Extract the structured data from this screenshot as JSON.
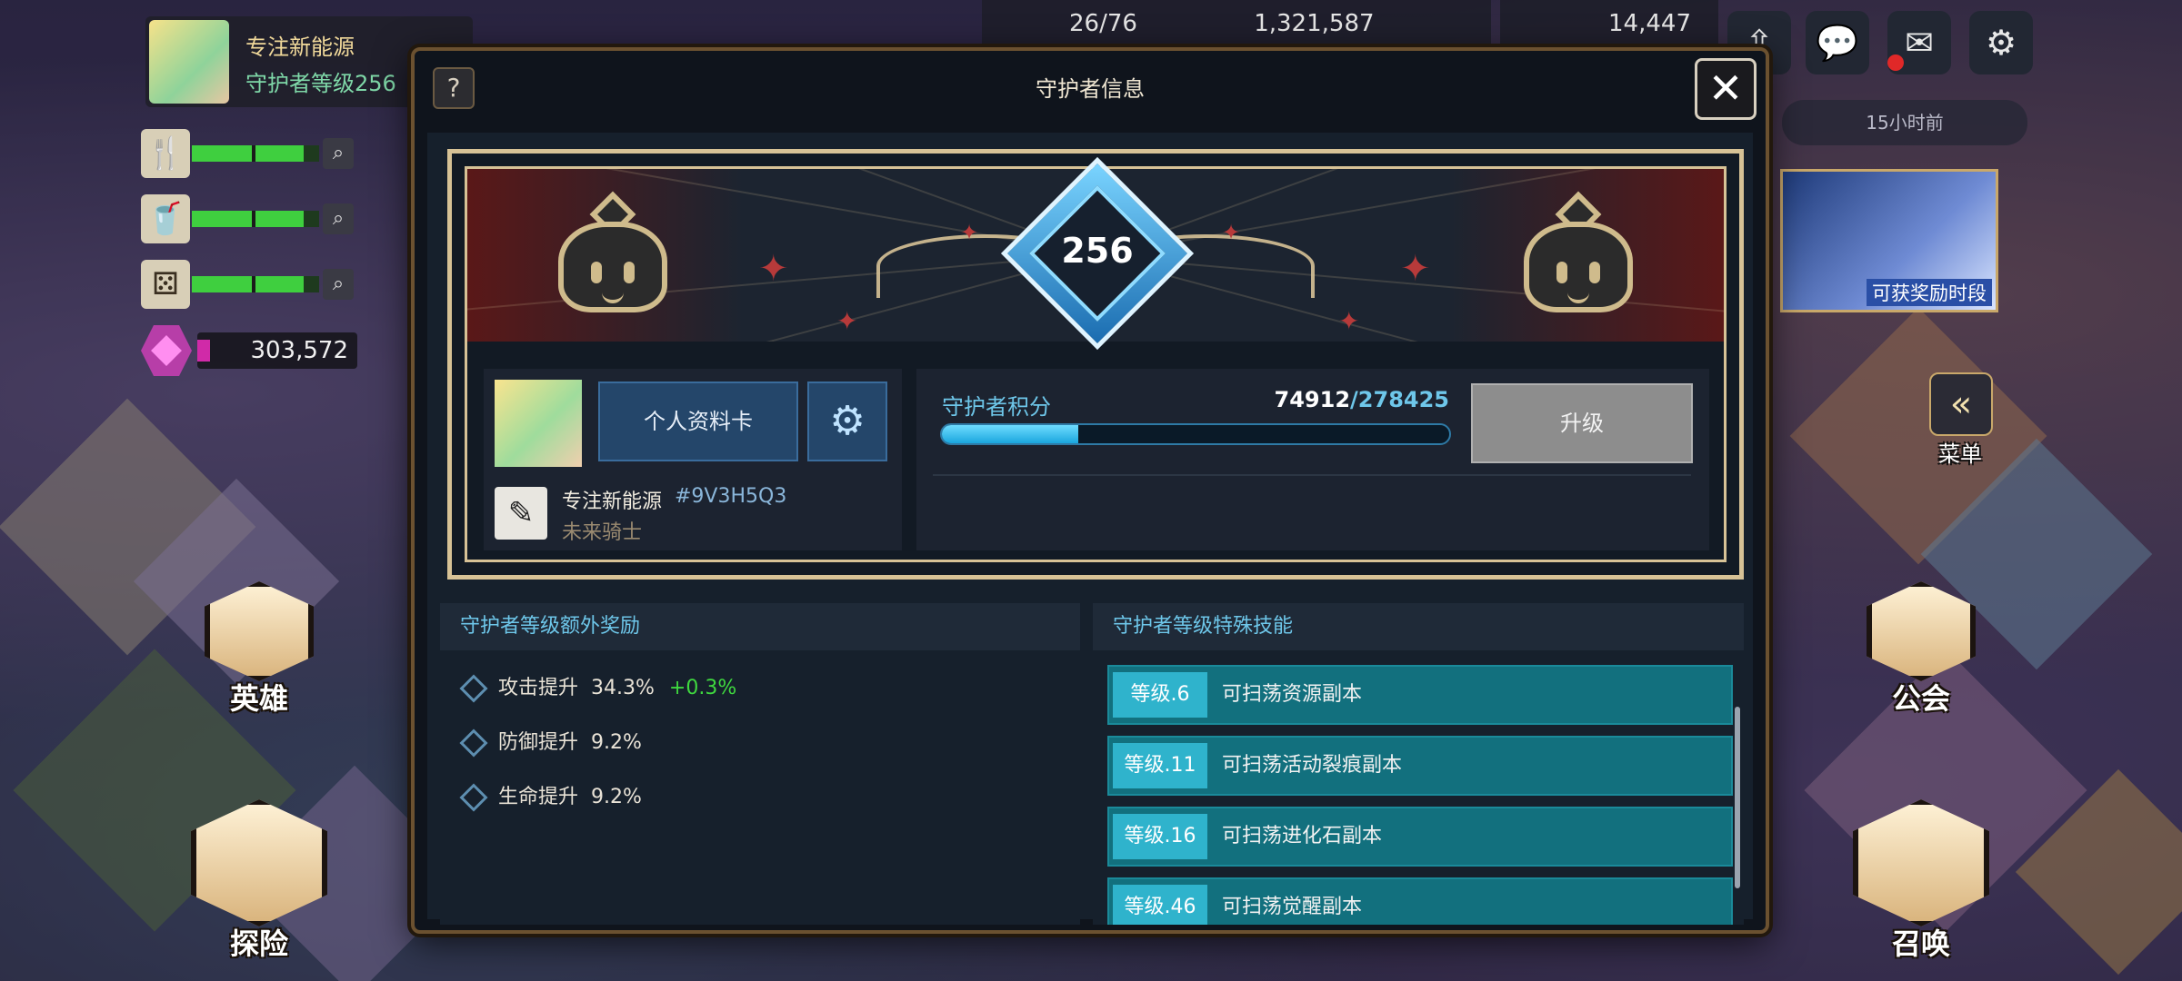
{
  "player": {
    "name": "专注新能源",
    "level_text": "守护者等级256"
  },
  "gem_count": "303,572",
  "resources": {
    "stamina": "26/76",
    "gold": "1,321,587",
    "diamond": "14,447"
  },
  "news_time": "15小时前",
  "promo_text": "可获奖励时段",
  "menu_label": "菜单",
  "left_buttons": [
    {
      "label": "英雄"
    },
    {
      "label": "探险"
    }
  ],
  "right_buttons": [
    {
      "label": "公会"
    },
    {
      "label": "召唤"
    }
  ],
  "dialog": {
    "title": "守护者信息",
    "help": "?",
    "close": "✕",
    "level": "256",
    "profile": {
      "card_button": "个人资料卡",
      "name": "专注新能源",
      "id": "#9V3H5Q3",
      "title": "未来骑士"
    },
    "points": {
      "label": "守护者积分",
      "current": "74912",
      "total": "/278425",
      "progress": 0.269
    },
    "upgrade_button": "升级",
    "bonus_panel": {
      "title": "守护者等级额外奖励",
      "items": [
        {
          "name": "攻击提升",
          "value": "34.3%",
          "increase": "+0.3%"
        },
        {
          "name": "防御提升",
          "value": "9.2%",
          "increase": ""
        },
        {
          "name": "生命提升",
          "value": "9.2%",
          "increase": ""
        }
      ]
    },
    "skill_panel": {
      "title": "守护者等级特殊技能",
      "items": [
        {
          "level": "等级.6",
          "desc": "可扫荡资源副本"
        },
        {
          "level": "等级.11",
          "desc": "可扫荡活动裂痕副本"
        },
        {
          "level": "等级.16",
          "desc": "可扫荡进化石副本"
        },
        {
          "level": "等级.46",
          "desc": "可扫荡觉醒副本"
        }
      ]
    }
  },
  "icons": [
    "fork-knife-icon",
    "cup-icon",
    "dice-icon",
    "magnifier-icon",
    "gem-icon",
    "share-icon",
    "chat-icon",
    "mail-icon",
    "gear-icon",
    "edit-icon",
    "close-icon",
    "help-icon"
  ]
}
